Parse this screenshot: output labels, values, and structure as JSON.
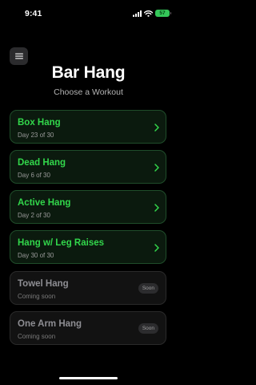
{
  "status": {
    "time": "9:41",
    "battery": "57"
  },
  "header": {
    "title": "Bar Hang",
    "subtitle": "Choose a Workout"
  },
  "colors": {
    "accent": "#32d74b",
    "background": "#000000",
    "card_active_border": "#1f4d2a",
    "disabled_text": "#8e8e93"
  },
  "workouts": [
    {
      "title": "Box Hang",
      "progress": "Day 23 of 30"
    },
    {
      "title": "Dead Hang",
      "progress": "Day 6 of 30"
    },
    {
      "title": "Active Hang",
      "progress": "Day 2 of 30"
    },
    {
      "title": "Hang w/ Leg Raises",
      "progress": "Day 30 of 30"
    },
    {
      "title": "Towel Hang",
      "progress": "Coming soon",
      "badge": "Soon"
    },
    {
      "title": "One Arm Hang",
      "progress": "Coming soon",
      "badge": "Soon"
    }
  ]
}
